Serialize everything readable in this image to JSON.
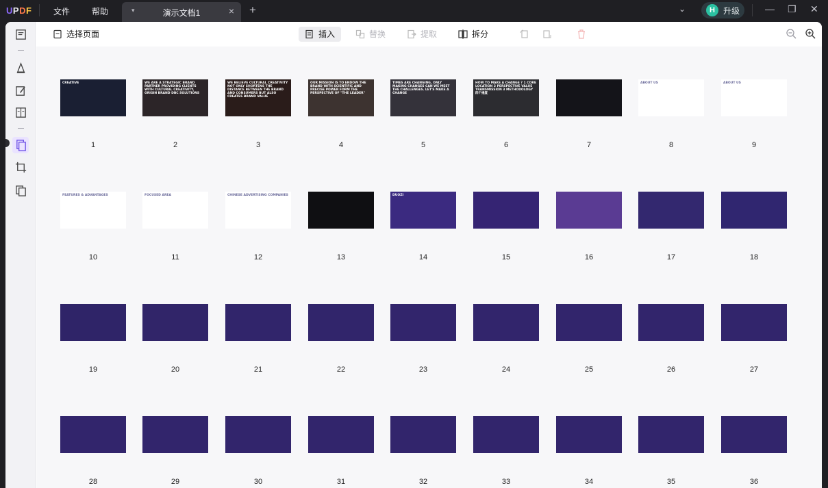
{
  "app": {
    "logo": "UPDF",
    "menu": [
      "文件",
      "帮助"
    ],
    "tab_title": "演示文档1",
    "upgrade_label": "升级",
    "upgrade_avatar": "H"
  },
  "toolbar": {
    "select_pages": "选择页面",
    "insert": "插入",
    "replace": "替换",
    "extract": "提取",
    "split": "拆分"
  },
  "pages": [
    {
      "n": "1",
      "bg": "#1a1f33",
      "text": "CREATIVE"
    },
    {
      "n": "2",
      "bg": "#2c2528",
      "text": "WE ARE A STRATEGIC BRAND PARTNER PROVIDING CLIENTS WITH CULTURAL CREATIVITY, ORIGIN BRAND DBC SOLUTIONS"
    },
    {
      "n": "3",
      "bg": "#2a1c1a",
      "text": "WE BELIEVE CULTURAL CREATIVITY NOT ONLY SHORTENS THE DISTANCE BETWEEN THE BRAND AND CONSUMERS BUT ALSO CREATES BRAND VALUE"
    },
    {
      "n": "4",
      "bg": "#3d3330",
      "text": "OUR MISSION IS TO ENDOW THE BRAND WITH SCIENTIFIC AND PRECISE POWER FORM THE PERSPECTIVE OF \"THE LEADER\""
    },
    {
      "n": "5",
      "bg": "#34323a",
      "text": "TIMES ARE CHANGING, ONLY MAKING CHANGES CAN WE MEET THE CHALLENGES. LET'S MAKE A CHANGE"
    },
    {
      "n": "6",
      "bg": "#2c2c30",
      "text": "HOW TO MAKE A CHANGE ? 1 CORE LOCATION 2 PERSPECTIVE VALUE TRANSMISSION 3 METHODOLOGY 四个维度"
    },
    {
      "n": "7",
      "bg": "#141419",
      "text": ""
    },
    {
      "n": "8",
      "bg": "#ffffff",
      "text": "ABOUT US"
    },
    {
      "n": "9",
      "bg": "#ffffff",
      "text": "ABOUT US"
    },
    {
      "n": "10",
      "bg": "#ffffff",
      "text": "FEATURES & ADVANTAGES"
    },
    {
      "n": "11",
      "bg": "#ffffff",
      "text": "FOCUSED AREA"
    },
    {
      "n": "12",
      "bg": "#ffffff",
      "text": "CHINESE ADVERTISING COMPANIES"
    },
    {
      "n": "13",
      "bg": "#0f0f12",
      "text": ""
    },
    {
      "n": "14",
      "bg": "#3b2a80",
      "text": "DUOZI"
    },
    {
      "n": "15",
      "bg": "#352473",
      "text": ""
    },
    {
      "n": "16",
      "bg": "#5a3b93",
      "text": ""
    },
    {
      "n": "17",
      "bg": "#33286f",
      "text": ""
    },
    {
      "n": "18",
      "bg": "#302670",
      "text": ""
    },
    {
      "n": "19",
      "bg": "#2f2468",
      "text": ""
    },
    {
      "n": "20",
      "bg": "#312569",
      "text": ""
    },
    {
      "n": "21",
      "bg": "#31256b",
      "text": ""
    },
    {
      "n": "22",
      "bg": "#31256b",
      "text": ""
    },
    {
      "n": "23",
      "bg": "#32256c",
      "text": ""
    },
    {
      "n": "24",
      "bg": "#32256c",
      "text": ""
    },
    {
      "n": "25",
      "bg": "#32256c",
      "text": ""
    },
    {
      "n": "26",
      "bg": "#32256c",
      "text": ""
    },
    {
      "n": "27",
      "bg": "#32256c",
      "text": ""
    },
    {
      "n": "28",
      "bg": "#32256c",
      "text": ""
    },
    {
      "n": "29",
      "bg": "#32256c",
      "text": ""
    },
    {
      "n": "30",
      "bg": "#32256c",
      "text": ""
    },
    {
      "n": "31",
      "bg": "#32256c",
      "text": ""
    },
    {
      "n": "32",
      "bg": "#32256c",
      "text": ""
    },
    {
      "n": "33",
      "bg": "#32256c",
      "text": ""
    },
    {
      "n": "34",
      "bg": "#32256c",
      "text": ""
    },
    {
      "n": "35",
      "bg": "#32256c",
      "text": ""
    },
    {
      "n": "36",
      "bg": "#32256c",
      "text": ""
    }
  ]
}
